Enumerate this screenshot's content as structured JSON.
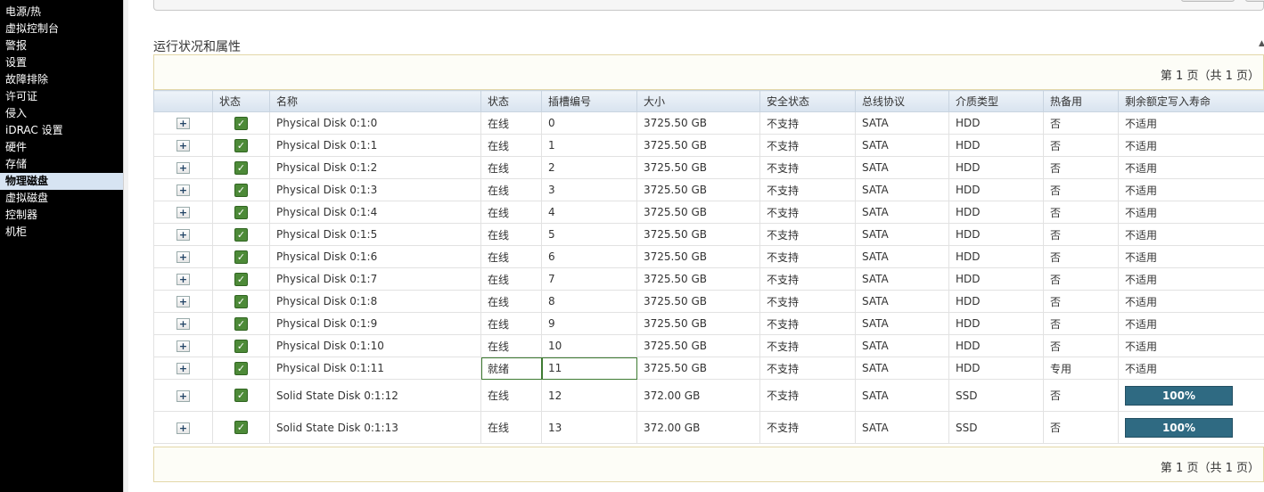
{
  "sidebar": {
    "items": [
      {
        "label": "电源/热",
        "active": false
      },
      {
        "label": "虚拟控制台",
        "active": false
      },
      {
        "label": "警报",
        "active": false
      },
      {
        "label": "设置",
        "active": false
      },
      {
        "label": "故障排除",
        "active": false
      },
      {
        "label": "许可证",
        "active": false
      },
      {
        "label": "侵入",
        "active": false
      },
      {
        "label": "iDRAC 设置",
        "active": false
      },
      {
        "label": "硬件",
        "active": false
      },
      {
        "label": "存储",
        "active": false
      },
      {
        "label": "物理磁盘",
        "active": true
      },
      {
        "label": "虚拟磁盘",
        "active": false
      },
      {
        "label": "控制器",
        "active": false
      },
      {
        "label": "机柜",
        "active": false
      }
    ]
  },
  "section": {
    "title": "运行状况和属性",
    "collapse_icon": "triangle-up-icon"
  },
  "pagination": {
    "top": "第 1 页（共 1 页）",
    "bottom": "第 1 页（共 1 页）"
  },
  "table": {
    "headers": {
      "expand": "",
      "status": "状态",
      "name": "名称",
      "state": "状态",
      "slot": "插槽编号",
      "size": "大小",
      "security": "安全状态",
      "bus": "总线协议",
      "media": "介质类型",
      "hotspare": "热备用",
      "life": "剩余额定写入寿命"
    },
    "rows": [
      {
        "name": "Physical Disk 0:1:0",
        "state": "在线",
        "slot": "0",
        "size": "3725.50 GB",
        "security": "不支持",
        "bus": "SATA",
        "media": "HDD",
        "hotspare": "否",
        "life": "不适用"
      },
      {
        "name": "Physical Disk 0:1:1",
        "state": "在线",
        "slot": "1",
        "size": "3725.50 GB",
        "security": "不支持",
        "bus": "SATA",
        "media": "HDD",
        "hotspare": "否",
        "life": "不适用"
      },
      {
        "name": "Physical Disk 0:1:2",
        "state": "在线",
        "slot": "2",
        "size": "3725.50 GB",
        "security": "不支持",
        "bus": "SATA",
        "media": "HDD",
        "hotspare": "否",
        "life": "不适用"
      },
      {
        "name": "Physical Disk 0:1:3",
        "state": "在线",
        "slot": "3",
        "size": "3725.50 GB",
        "security": "不支持",
        "bus": "SATA",
        "media": "HDD",
        "hotspare": "否",
        "life": "不适用"
      },
      {
        "name": "Physical Disk 0:1:4",
        "state": "在线",
        "slot": "4",
        "size": "3725.50 GB",
        "security": "不支持",
        "bus": "SATA",
        "media": "HDD",
        "hotspare": "否",
        "life": "不适用"
      },
      {
        "name": "Physical Disk 0:1:5",
        "state": "在线",
        "slot": "5",
        "size": "3725.50 GB",
        "security": "不支持",
        "bus": "SATA",
        "media": "HDD",
        "hotspare": "否",
        "life": "不适用"
      },
      {
        "name": "Physical Disk 0:1:6",
        "state": "在线",
        "slot": "6",
        "size": "3725.50 GB",
        "security": "不支持",
        "bus": "SATA",
        "media": "HDD",
        "hotspare": "否",
        "life": "不适用"
      },
      {
        "name": "Physical Disk 0:1:7",
        "state": "在线",
        "slot": "7",
        "size": "3725.50 GB",
        "security": "不支持",
        "bus": "SATA",
        "media": "HDD",
        "hotspare": "否",
        "life": "不适用"
      },
      {
        "name": "Physical Disk 0:1:8",
        "state": "在线",
        "slot": "8",
        "size": "3725.50 GB",
        "security": "不支持",
        "bus": "SATA",
        "media": "HDD",
        "hotspare": "否",
        "life": "不适用"
      },
      {
        "name": "Physical Disk 0:1:9",
        "state": "在线",
        "slot": "9",
        "size": "3725.50 GB",
        "security": "不支持",
        "bus": "SATA",
        "media": "HDD",
        "hotspare": "否",
        "life": "不适用"
      },
      {
        "name": "Physical Disk 0:1:10",
        "state": "在线",
        "slot": "10",
        "size": "3725.50 GB",
        "security": "不支持",
        "bus": "SATA",
        "media": "HDD",
        "hotspare": "否",
        "life": "不适用"
      },
      {
        "name": "Physical Disk 0:1:11",
        "state": "就绪",
        "slot": "11",
        "size": "3725.50 GB",
        "security": "不支持",
        "bus": "SATA",
        "media": "HDD",
        "hotspare": "专用",
        "life": "不适用"
      },
      {
        "name": "Solid State Disk 0:1:12",
        "state": "在线",
        "slot": "12",
        "size": "372.00 GB",
        "security": "不支持",
        "bus": "SATA",
        "media": "SSD",
        "hotspare": "否",
        "life": "100%",
        "life_percent": 100
      },
      {
        "name": "Solid State Disk 0:1:13",
        "state": "在线",
        "slot": "13",
        "size": "372.00 GB",
        "security": "不支持",
        "bus": "SATA",
        "media": "SSD",
        "hotspare": "否",
        "life": "100%",
        "life_percent": 100
      }
    ]
  },
  "icons": {
    "expand": "plus-expand-icon",
    "status_ok": "status-ok-check-icon"
  },
  "colors": {
    "status_ok": "#4d8a38",
    "life_bar": "#2f6a82",
    "sidebar_bg": "#000000",
    "sidebar_active": "#d7e4f2"
  }
}
